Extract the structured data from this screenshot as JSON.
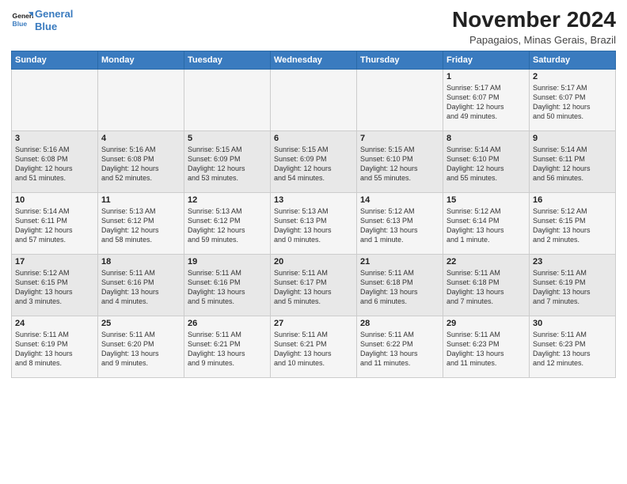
{
  "logo": {
    "line1": "General",
    "line2": "Blue"
  },
  "title": "November 2024",
  "subtitle": "Papagaios, Minas Gerais, Brazil",
  "weekdays": [
    "Sunday",
    "Monday",
    "Tuesday",
    "Wednesday",
    "Thursday",
    "Friday",
    "Saturday"
  ],
  "weeks": [
    [
      {
        "day": "",
        "info": ""
      },
      {
        "day": "",
        "info": ""
      },
      {
        "day": "",
        "info": ""
      },
      {
        "day": "",
        "info": ""
      },
      {
        "day": "",
        "info": ""
      },
      {
        "day": "1",
        "info": "Sunrise: 5:17 AM\nSunset: 6:07 PM\nDaylight: 12 hours\nand 49 minutes."
      },
      {
        "day": "2",
        "info": "Sunrise: 5:17 AM\nSunset: 6:07 PM\nDaylight: 12 hours\nand 50 minutes."
      }
    ],
    [
      {
        "day": "3",
        "info": "Sunrise: 5:16 AM\nSunset: 6:08 PM\nDaylight: 12 hours\nand 51 minutes."
      },
      {
        "day": "4",
        "info": "Sunrise: 5:16 AM\nSunset: 6:08 PM\nDaylight: 12 hours\nand 52 minutes."
      },
      {
        "day": "5",
        "info": "Sunrise: 5:15 AM\nSunset: 6:09 PM\nDaylight: 12 hours\nand 53 minutes."
      },
      {
        "day": "6",
        "info": "Sunrise: 5:15 AM\nSunset: 6:09 PM\nDaylight: 12 hours\nand 54 minutes."
      },
      {
        "day": "7",
        "info": "Sunrise: 5:15 AM\nSunset: 6:10 PM\nDaylight: 12 hours\nand 55 minutes."
      },
      {
        "day": "8",
        "info": "Sunrise: 5:14 AM\nSunset: 6:10 PM\nDaylight: 12 hours\nand 55 minutes."
      },
      {
        "day": "9",
        "info": "Sunrise: 5:14 AM\nSunset: 6:11 PM\nDaylight: 12 hours\nand 56 minutes."
      }
    ],
    [
      {
        "day": "10",
        "info": "Sunrise: 5:14 AM\nSunset: 6:11 PM\nDaylight: 12 hours\nand 57 minutes."
      },
      {
        "day": "11",
        "info": "Sunrise: 5:13 AM\nSunset: 6:12 PM\nDaylight: 12 hours\nand 58 minutes."
      },
      {
        "day": "12",
        "info": "Sunrise: 5:13 AM\nSunset: 6:12 PM\nDaylight: 12 hours\nand 59 minutes."
      },
      {
        "day": "13",
        "info": "Sunrise: 5:13 AM\nSunset: 6:13 PM\nDaylight: 13 hours\nand 0 minutes."
      },
      {
        "day": "14",
        "info": "Sunrise: 5:12 AM\nSunset: 6:13 PM\nDaylight: 13 hours\nand 1 minute."
      },
      {
        "day": "15",
        "info": "Sunrise: 5:12 AM\nSunset: 6:14 PM\nDaylight: 13 hours\nand 1 minute."
      },
      {
        "day": "16",
        "info": "Sunrise: 5:12 AM\nSunset: 6:15 PM\nDaylight: 13 hours\nand 2 minutes."
      }
    ],
    [
      {
        "day": "17",
        "info": "Sunrise: 5:12 AM\nSunset: 6:15 PM\nDaylight: 13 hours\nand 3 minutes."
      },
      {
        "day": "18",
        "info": "Sunrise: 5:11 AM\nSunset: 6:16 PM\nDaylight: 13 hours\nand 4 minutes."
      },
      {
        "day": "19",
        "info": "Sunrise: 5:11 AM\nSunset: 6:16 PM\nDaylight: 13 hours\nand 5 minutes."
      },
      {
        "day": "20",
        "info": "Sunrise: 5:11 AM\nSunset: 6:17 PM\nDaylight: 13 hours\nand 5 minutes."
      },
      {
        "day": "21",
        "info": "Sunrise: 5:11 AM\nSunset: 6:18 PM\nDaylight: 13 hours\nand 6 minutes."
      },
      {
        "day": "22",
        "info": "Sunrise: 5:11 AM\nSunset: 6:18 PM\nDaylight: 13 hours\nand 7 minutes."
      },
      {
        "day": "23",
        "info": "Sunrise: 5:11 AM\nSunset: 6:19 PM\nDaylight: 13 hours\nand 7 minutes."
      }
    ],
    [
      {
        "day": "24",
        "info": "Sunrise: 5:11 AM\nSunset: 6:19 PM\nDaylight: 13 hours\nand 8 minutes."
      },
      {
        "day": "25",
        "info": "Sunrise: 5:11 AM\nSunset: 6:20 PM\nDaylight: 13 hours\nand 9 minutes."
      },
      {
        "day": "26",
        "info": "Sunrise: 5:11 AM\nSunset: 6:21 PM\nDaylight: 13 hours\nand 9 minutes."
      },
      {
        "day": "27",
        "info": "Sunrise: 5:11 AM\nSunset: 6:21 PM\nDaylight: 13 hours\nand 10 minutes."
      },
      {
        "day": "28",
        "info": "Sunrise: 5:11 AM\nSunset: 6:22 PM\nDaylight: 13 hours\nand 11 minutes."
      },
      {
        "day": "29",
        "info": "Sunrise: 5:11 AM\nSunset: 6:23 PM\nDaylight: 13 hours\nand 11 minutes."
      },
      {
        "day": "30",
        "info": "Sunrise: 5:11 AM\nSunset: 6:23 PM\nDaylight: 13 hours\nand 12 minutes."
      }
    ]
  ]
}
